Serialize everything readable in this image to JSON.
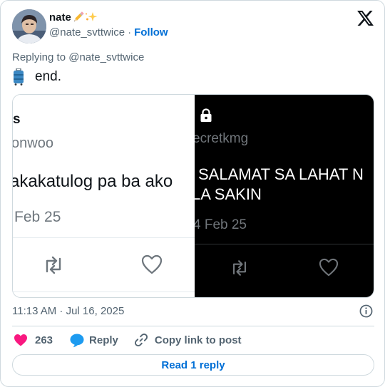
{
  "author": {
    "name": "nate",
    "handle": "@nate_svttwice",
    "separator": "·",
    "follow_label": "Follow"
  },
  "tweet": {
    "reply_label": "Replying to @nate_svttwice",
    "text": "end.",
    "timestamp": "11:13 AM · Jul 16, 2025"
  },
  "media": {
    "left_panel": {
      "name_fragment": "s",
      "handle_fragment": "onwoo",
      "text_fragment": "akakatulog pa ba ako",
      "date_fragment": "Feb 25"
    },
    "right_panel": {
      "handle_fragment": "ecretkmg",
      "text_line1": "SALAMAT SA LAHAT N",
      "text_line2": "LA SAKIN",
      "date_fragment": "4 Feb 25"
    }
  },
  "actions": {
    "like_count": "263",
    "reply_label": "Reply",
    "copy_link_label": "Copy link to post"
  },
  "read_reply_label": "Read 1 reply",
  "colors": {
    "accent": "#006fd6",
    "like": "#f91880",
    "reply_bubble": "#1d9bf0",
    "text_secondary": "#536471"
  },
  "icons": {
    "logo": "x-logo-icon",
    "info": "info-icon",
    "like": "heart-icon",
    "reply": "speech-bubble-icon",
    "copy_link": "link-icon"
  }
}
